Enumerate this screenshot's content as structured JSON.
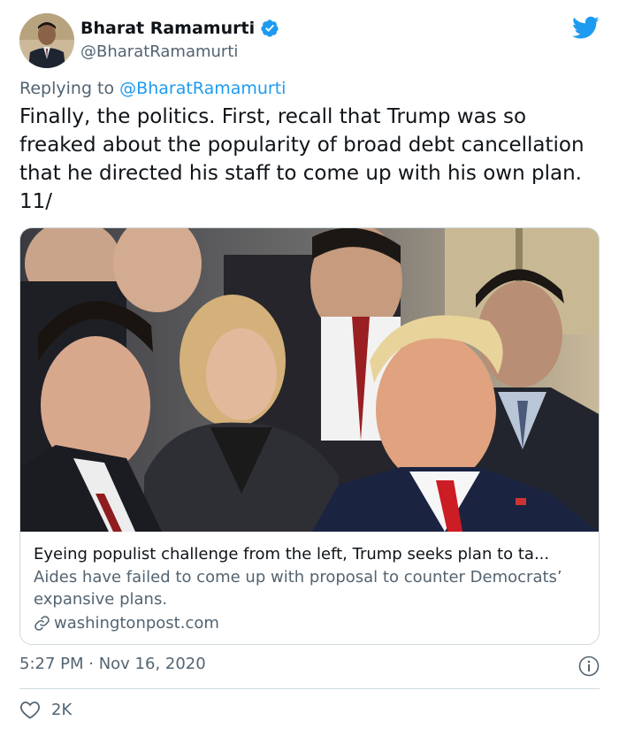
{
  "author": {
    "name": "Bharat Ramamurti",
    "handle": "@BharatRamamurti"
  },
  "reply": {
    "prefix": "Replying to ",
    "to": "@BharatRamamurti"
  },
  "tweet": {
    "text": "Finally, the politics. First, recall that Trump was so freaked about the popularity of broad debt cancellation that he directed his staff to come up with his own plan. 11/"
  },
  "card": {
    "title": "Eyeing populist challenge from the left, Trump seeks plan to ta...",
    "description": "Aides have failed to come up with proposal to counter Democrats’ expansive plans.",
    "domain": "washingtonpost.com"
  },
  "meta": {
    "timestamp": "5:27 PM · Nov 16, 2020",
    "likes": "2K"
  },
  "colors": {
    "accent": "#1d9bf0",
    "secondary_text": "#536471",
    "border": "#cfd9de"
  },
  "icons": [
    "verified-badge-icon",
    "twitter-bird-icon",
    "link-icon",
    "info-icon",
    "heart-icon"
  ]
}
